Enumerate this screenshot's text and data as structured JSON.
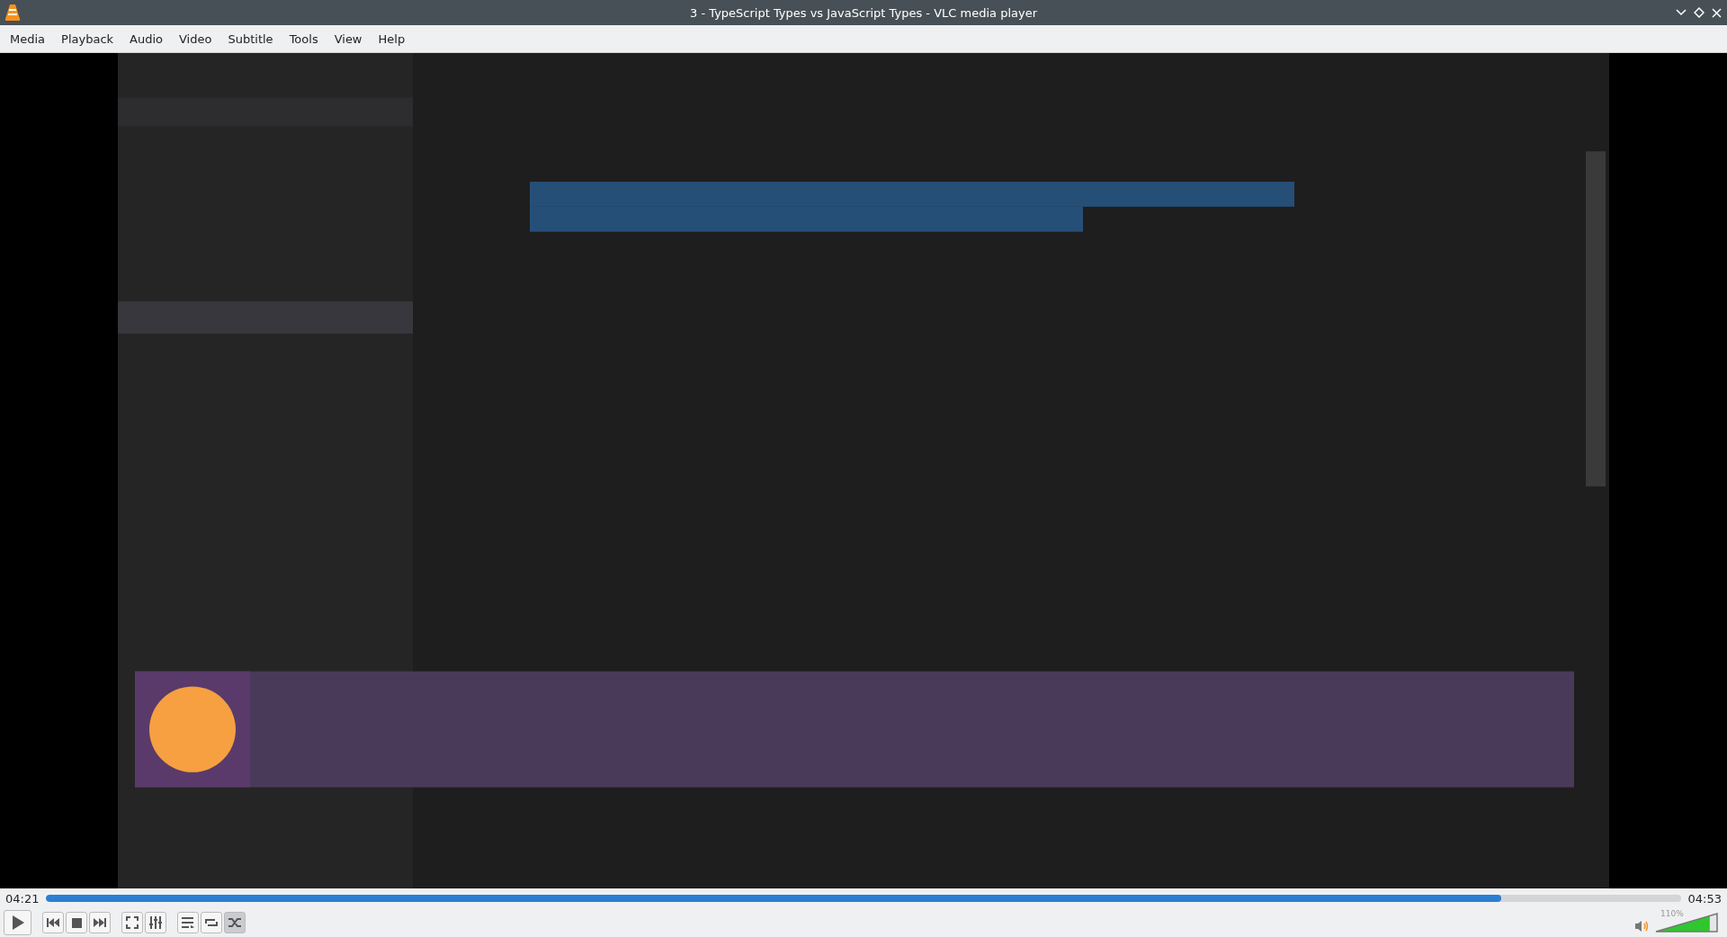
{
  "window": {
    "title": "3 - TypeScript Types vs JavaScript Types - VLC media player"
  },
  "menu": [
    "Media",
    "Playback",
    "Audio",
    "Video",
    "Subtitle",
    "Tools",
    "View",
    "Help"
  ],
  "video": {
    "kind": "picture"
  },
  "seek": {
    "elapsed": "04:21",
    "total": "04:53",
    "level": 0.89
  },
  "controls": [
    {
      "kind": "play",
      "pressed": false
    },
    {
      "kind": "previous",
      "pressed": false
    },
    {
      "kind": "stop",
      "pressed": false
    },
    {
      "kind": "next",
      "pressed": false
    },
    {
      "kind": "fullscreen",
      "pressed": false
    },
    {
      "kind": "extended",
      "pressed": false
    },
    {
      "kind": "playlist",
      "pressed": false
    },
    {
      "kind": "loop",
      "pressed": false
    },
    {
      "kind": "shuffle",
      "pressed": true
    }
  ],
  "volume": {
    "reading": "110%",
    "level": 0.88
  }
}
